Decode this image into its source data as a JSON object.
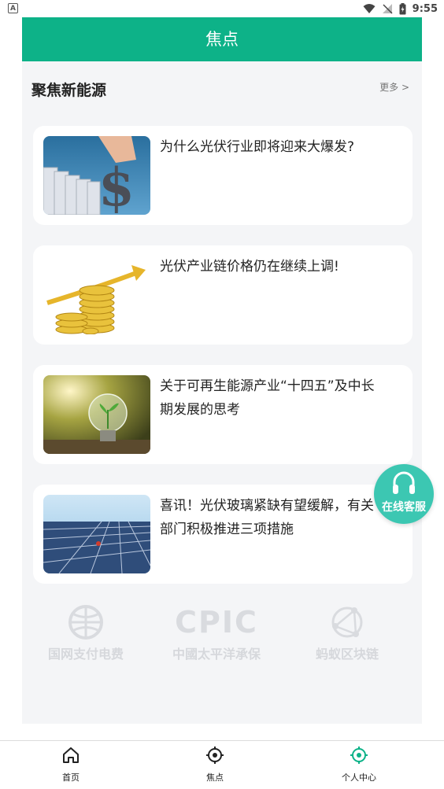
{
  "status_bar": {
    "time": "9:55",
    "app_badge": "A"
  },
  "header": {
    "title": "焦点"
  },
  "section": {
    "title": "聚焦新能源",
    "more": "更多 >"
  },
  "articles": [
    {
      "title": "为什么光伏行业即将迎来大爆发?"
    },
    {
      "title": "光伏产业链价格仍在继续上调!"
    },
    {
      "title": "关于可再生能源产业“十四五”及中长期发展的思考"
    },
    {
      "title": "喜讯！光伏玻璃紧缺有望缓解，有关部门积极推进三项措施"
    }
  ],
  "partners": [
    {
      "name": "国网支付电费",
      "logo": "globe-logo"
    },
    {
      "name": "中國太平洋承保",
      "logo_text": "CPIC"
    },
    {
      "name": "蚂蚁区块链",
      "logo": "network-logo"
    }
  ],
  "service_button": {
    "label": "在线客服",
    "icon": "headset-icon"
  },
  "tabbar": {
    "tabs": [
      {
        "label": "首页",
        "icon": "home-icon"
      },
      {
        "label": "焦点",
        "icon": "target-icon"
      },
      {
        "label": "个人中心",
        "icon": "target-icon",
        "active": true
      }
    ]
  },
  "colors": {
    "brand": "#0db288",
    "service": "#3cc7b2",
    "background": "#f4f5f7"
  }
}
